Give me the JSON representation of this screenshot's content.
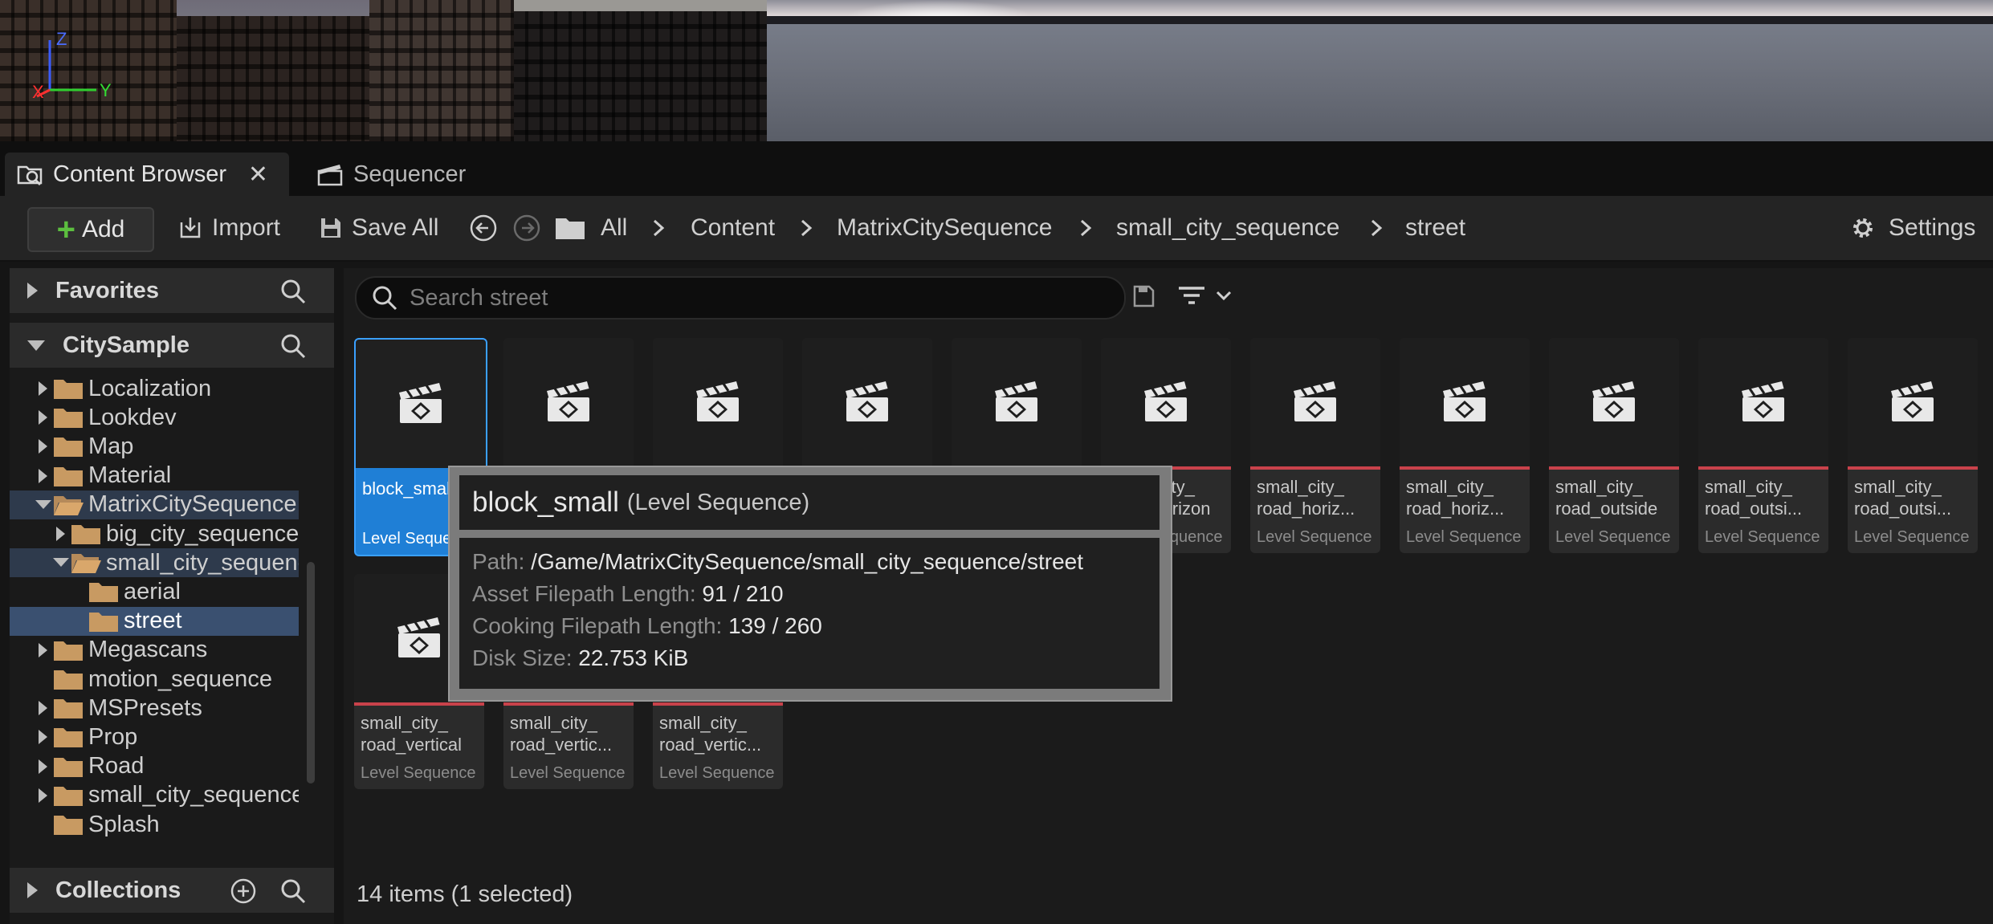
{
  "viewport": {
    "axis": {
      "x": "X",
      "y": "Y",
      "z": "Z"
    }
  },
  "tabs": [
    {
      "label": "Content Browser",
      "icon": "content-browser-icon",
      "closable": true
    },
    {
      "label": "Sequencer",
      "icon": "clapperboard-icon"
    }
  ],
  "toolbar": {
    "add_label": "Add",
    "import_label": "Import",
    "save_all_label": "Save All",
    "settings_label": "Settings",
    "breadcrumb": [
      "All",
      "Content",
      "MatrixCitySequence",
      "small_city_sequence",
      "street"
    ]
  },
  "left_panel": {
    "favorites": "Favorites",
    "citysample": "CitySample",
    "collections": "Collections",
    "tree": [
      "Localization",
      "Lookdev",
      "Map",
      "Material",
      "MatrixCitySequence",
      "big_city_sequence",
      "small_city_sequence",
      "aerial",
      "street",
      "Megascans",
      "motion_sequence",
      "MSPresets",
      "Prop",
      "Road",
      "small_city_sequence",
      "Splash"
    ]
  },
  "search": {
    "placeholder": "Search street"
  },
  "assets": [
    {
      "name": "block_small",
      "type": "Level Sequence",
      "selected": true
    },
    {
      "name": "",
      "type": ""
    },
    {
      "name": "",
      "type": ""
    },
    {
      "name": "",
      "type": ""
    },
    {
      "name": "",
      "type": ""
    },
    {
      "name": "small_city_\nroad_horizon",
      "type": "Level Sequence"
    },
    {
      "name": "small_city_\nroad_horiz...",
      "type": "Level Sequence"
    },
    {
      "name": "small_city_\nroad_horiz...",
      "type": "Level Sequence"
    },
    {
      "name": "small_city_\nroad_outside",
      "type": "Level Sequence"
    },
    {
      "name": "small_city_\nroad_outsi...",
      "type": "Level Sequence"
    },
    {
      "name": "small_city_\nroad_outsi...",
      "type": "Level Sequence"
    },
    {
      "name": "small_city_\nroad_vertical",
      "type": "Level Sequence"
    },
    {
      "name": "small_city_\nroad_vertic...",
      "type": "Level Sequence"
    },
    {
      "name": "small_city_\nroad_vertic...",
      "type": "Level Sequence"
    }
  ],
  "tooltip": {
    "title": "block_small",
    "subtitle": "(Level Sequence)",
    "path_label": "Path:",
    "path": "/Game/MatrixCitySequence/small_city_sequence/street",
    "asset_len_label": "Asset Filepath Length:",
    "asset_len": "91 / 210",
    "cook_len_label": "Cooking Filepath Length:",
    "cook_len": "139 / 260",
    "disk_label": "Disk Size:",
    "disk": "22.753 KiB"
  },
  "status": "14 items (1 selected)",
  "colors": {
    "accent": "#1f7fd6",
    "sequence_bar": "#c9424b",
    "add_green": "#5cbf3f"
  }
}
